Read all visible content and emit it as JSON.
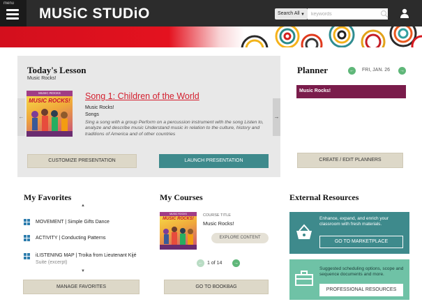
{
  "header": {
    "menu_label": "menu",
    "logo": "MUSiC STUDiO",
    "search_scope": "Search All",
    "search_placeholder": "keywords"
  },
  "todays_lesson": {
    "title": "Today's Lesson",
    "subtitle": "Music Rocks!",
    "cover_top": "MUSIC ROCKS",
    "cover_title": "MUSIC ROCKS!",
    "song_link": "Song 1: Children of the World",
    "book": "Music Rocks!",
    "category": "Songs",
    "description": "Sing a song with a group Perform on a percussion instrument with the song Listen to, analyze and describe music Understand music in relation to the culture, history and traditions of America and of other countries",
    "customize_btn": "CUSTOMIZE PRESENTATION",
    "launch_btn": "LAUNCH PRESENTATION"
  },
  "planner": {
    "title": "Planner",
    "date": "FRI, JAN. 26",
    "entry": "Music Rocks!",
    "edit_btn": "CREATE / EDIT PLANNERS"
  },
  "favorites": {
    "title": "My Favorites",
    "items": [
      {
        "label": "MOVEMENT | Simple Gifts Dance",
        "sub": ""
      },
      {
        "label": "ACTIVITY | Conducting Patterns",
        "sub": ""
      },
      {
        "label": "iLISTENING MAP | Troika from Lieutenant Kijé",
        "sub": "Suite (excerpt)"
      }
    ],
    "manage_btn": "MANAGE FAVORITES"
  },
  "courses": {
    "title": "My Courses",
    "course_label": "COURSE TITLE",
    "course_name": "Music Rocks!",
    "cover_top": "MUSIC ROCKS",
    "cover_title": "MUSIC ROCKS!",
    "explore_btn": "EXPLORE CONTENT",
    "page": "1",
    "of": "of",
    "total": "14",
    "bookbag_btn": "GO TO BOOKBAG"
  },
  "resources": {
    "title": "External Resources",
    "marketplace_text": "Enhance, expand, and enrich your classroom with fresh materials.",
    "marketplace_btn": "GO TO MARKETPLACE",
    "professional_text": "Suggested scheduling options, scope and sequence documents and more.",
    "professional_btn": "PROFESSIONAL RESOURCES",
    "marketplace_color": "#3e8a8c",
    "professional_color": "#6fc2a6"
  }
}
